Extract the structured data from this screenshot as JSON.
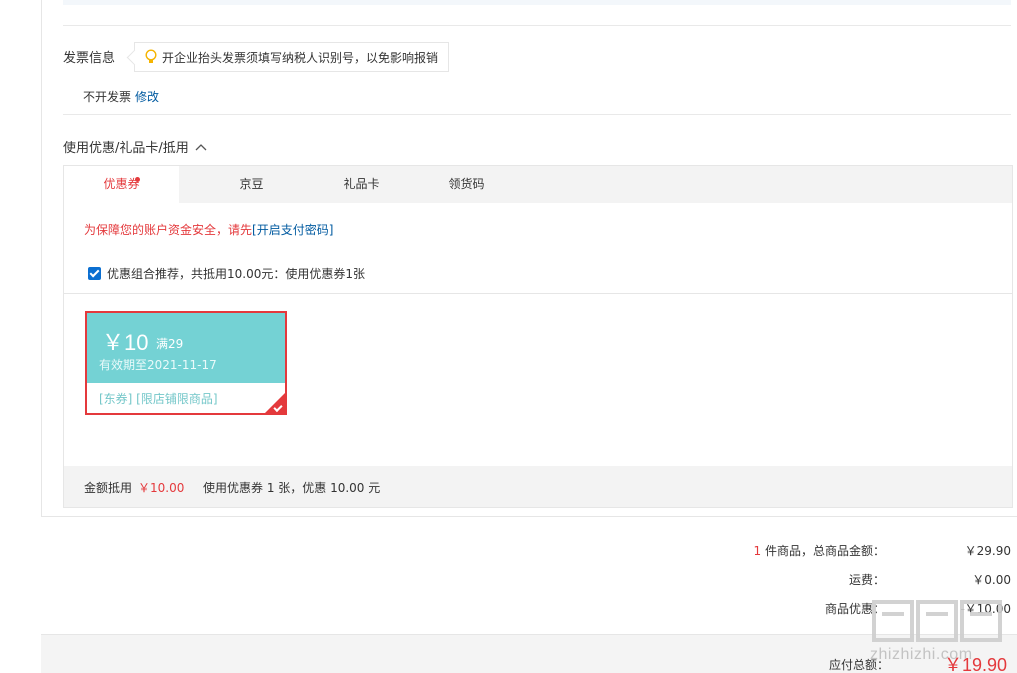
{
  "invoice": {
    "title": "发票信息",
    "tip": "开企业抬头发票须填写纳税人识别号，以免影响报销",
    "value": "不开发票",
    "edit_label": "修改"
  },
  "coupon_section": {
    "title": "使用优惠/礼品卡/抵用",
    "tabs": [
      {
        "label": "优惠券",
        "active": true,
        "has_dot": true
      },
      {
        "label": "京豆",
        "active": false
      },
      {
        "label": "礼品卡",
        "active": false
      },
      {
        "label": "领货码",
        "active": false
      }
    ],
    "warning_text": "为保障您的账户资金安全，请先",
    "warning_link": "[开启支付密码]",
    "recommend_checked": true,
    "recommend_text": "优惠组合推荐，共抵用10.00元：使用优惠券1张",
    "coupon": {
      "amount": "￥10",
      "quota": "满29",
      "valid": "有效期至2021-11-17",
      "tags": "[东券] [限店铺限商品]",
      "selected": true
    },
    "summary_label": "金额抵用",
    "summary_amount": "￥10.00",
    "summary_desc": "使用优惠券 1 张，优惠 10.00 元"
  },
  "totals": {
    "count": "1",
    "count_suffix": " 件商品，总商品金额：",
    "goods_total": "￥29.90",
    "shipping_label": "运费：",
    "shipping": "￥0.00",
    "discount_label": "商品优惠：",
    "discount": "-￥10.00",
    "pay_label": "应付总额：",
    "pay_total": "￥19.90"
  },
  "watermark": {
    "text": "zhizhizhi.com"
  },
  "colors": {
    "accent_red": "#e4393c",
    "link_blue": "#005aa0",
    "coupon_teal": "#74d2d4"
  }
}
